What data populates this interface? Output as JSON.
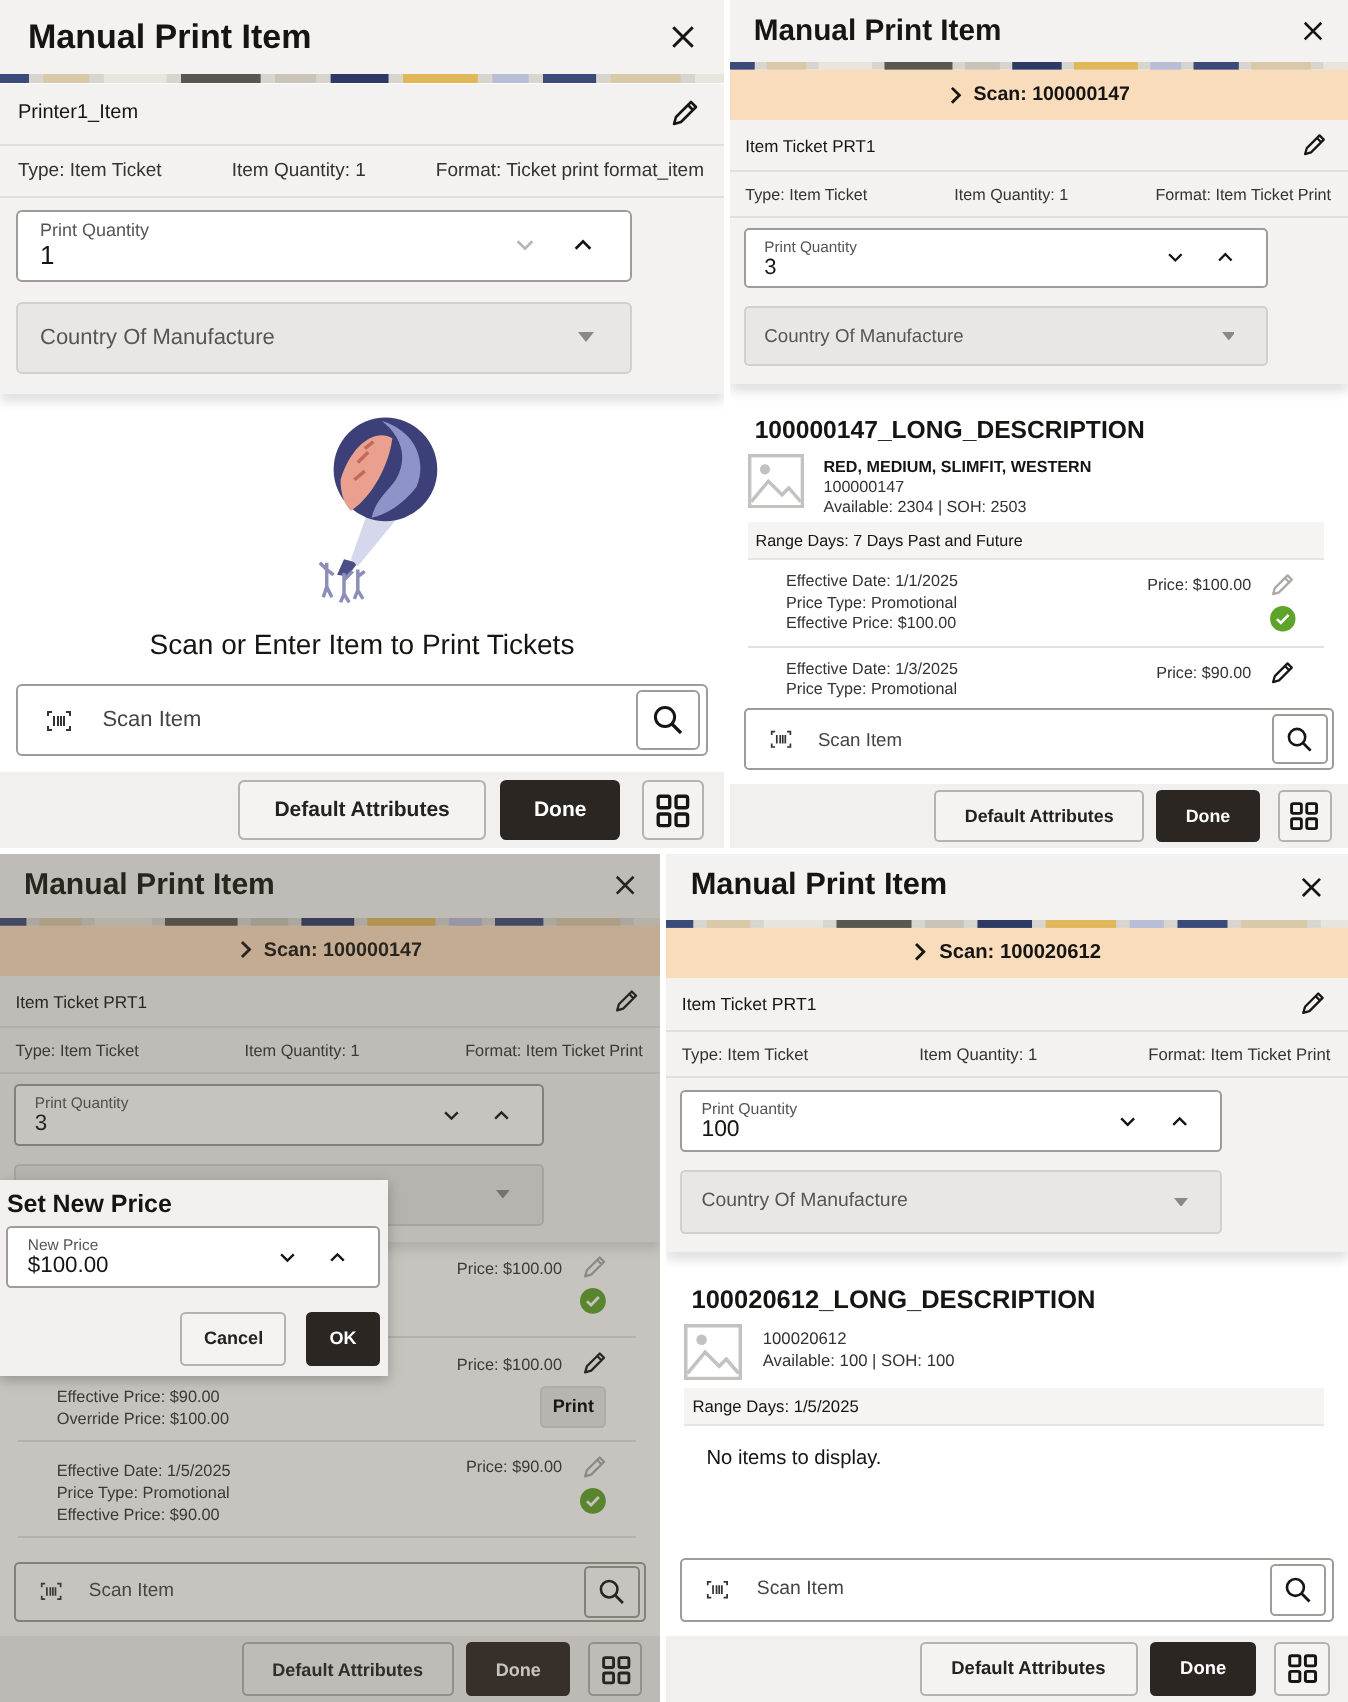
{
  "panels": [
    {
      "title": "Manual Print Item",
      "printer": "Printer1_Item",
      "info": [
        "Type: Item Ticket",
        "Item Quantity: 1",
        "Format: Ticket print format_item"
      ],
      "print_quantity": {
        "label": "Print Quantity",
        "value": "1",
        "can_decrease": false
      },
      "country": {
        "placeholder": "Country Of Manufacture"
      },
      "content": {
        "kind": "empty",
        "message": "Scan or Enter Item to Print Tickets"
      },
      "scan": {
        "placeholder": "Scan Item"
      },
      "buttons": [
        {
          "label": "Default Attributes",
          "kind": "secondary"
        },
        {
          "label": "Done",
          "kind": "primary"
        },
        {
          "kind": "grid"
        }
      ]
    },
    {
      "title": "Manual Print Item",
      "scan_banner": "Scan: 100000147",
      "printer": "Item Ticket PRT1",
      "info": [
        "Type: Item Ticket",
        "Item Quantity: 1",
        "Format: Item Ticket Print"
      ],
      "print_quantity": {
        "label": "Print Quantity",
        "value": "3",
        "can_decrease": true
      },
      "country": {
        "placeholder": "Country Of Manufacture"
      },
      "content": {
        "kind": "item",
        "title": "100000147_LONG_DESCRIPTION",
        "variant": "RED, MEDIUM, SLIMFIT, WESTERN",
        "id": "100000147",
        "stock": "Available: 2304 | SOH: 2503",
        "range": "Range Days: 7 Days Past and Future",
        "prices": [
          {
            "lines": [
              "Effective Date: 1/1/2025",
              "Price Type: Promotional",
              "Effective Price: $100.00"
            ],
            "price": "Price: $100.00",
            "kind": "applied"
          },
          {
            "lines": [
              "Effective Date: 1/3/2025",
              "Price Type: Promotional"
            ],
            "price": "Price: $90.00",
            "kind": "pending"
          }
        ]
      },
      "scan": {
        "placeholder": "Scan Item"
      },
      "buttons": [
        {
          "label": "Default Attributes",
          "kind": "secondary"
        },
        {
          "label": "Done",
          "kind": "primary"
        },
        {
          "kind": "grid"
        }
      ]
    },
    {
      "title": "Manual Print Item",
      "scan_banner": "Scan: 100000147",
      "printer": "Item Ticket PRT1",
      "info": [
        "Type: Item Ticket",
        "Item Quantity: 1",
        "Format: Item Ticket Print"
      ],
      "print_quantity": {
        "label": "Print Quantity",
        "value": "3",
        "can_decrease": true
      },
      "content": {
        "kind": "item",
        "prices": [
          {
            "price": "Price: $100.00",
            "kind": "applied"
          },
          {
            "lines": [
              "Effective Price: $90.00",
              "Override Price: $100.00"
            ],
            "price": "Price: $100.00",
            "kind": "pending",
            "action": "Print"
          },
          {
            "lines": [
              "Effective Date: 1/5/2025",
              "Price Type: Promotional",
              "Effective Price: $90.00"
            ],
            "price": "Price: $90.00",
            "kind": "applied"
          }
        ]
      },
      "scan": {
        "placeholder": "Scan Item"
      },
      "buttons": [
        {
          "label": "Default Attributes",
          "kind": "secondary"
        },
        {
          "label": "Done",
          "kind": "primary"
        },
        {
          "kind": "grid"
        }
      ],
      "dimmed": true,
      "dialog": {
        "title": "Set New Price",
        "field": {
          "label": "New Price",
          "value": "$100.00"
        },
        "buttons": [
          {
            "label": "Cancel",
            "kind": "secondary"
          },
          {
            "label": "OK",
            "kind": "primary"
          }
        ]
      }
    },
    {
      "title": "Manual Print Item",
      "scan_banner": "Scan: 100020612",
      "printer": "Item Ticket PRT1",
      "info": [
        "Type: Item Ticket",
        "Item Quantity: 1",
        "Format: Item Ticket Print"
      ],
      "print_quantity": {
        "label": "Print Quantity",
        "value": "100",
        "can_decrease": true
      },
      "country": {
        "placeholder": "Country Of Manufacture"
      },
      "content": {
        "kind": "item",
        "title": "100020612_LONG_DESCRIPTION",
        "id": "100020612",
        "stock": "Available: 100 | SOH: 100",
        "range": "Range Days: 1/5/2025",
        "message": "No items to display."
      },
      "scan": {
        "placeholder": "Scan Item"
      },
      "buttons": [
        {
          "label": "Default Attributes",
          "kind": "secondary"
        },
        {
          "label": "Done",
          "kind": "primary"
        },
        {
          "kind": "grid"
        }
      ]
    }
  ]
}
